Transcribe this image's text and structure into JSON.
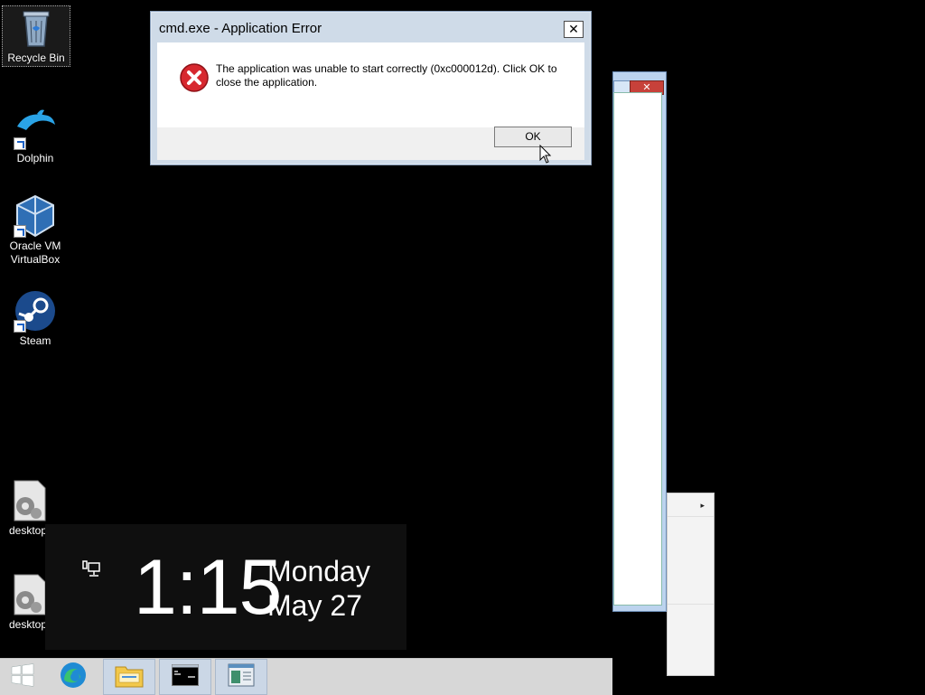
{
  "desktop": {
    "icons": [
      {
        "label": "Recycle Bin",
        "icon": "recycle-bin-icon"
      },
      {
        "label": "Dolphin",
        "icon": "dolphin-icon"
      },
      {
        "label": "Oracle VM\nVirtualBox",
        "icon": "virtualbox-icon"
      },
      {
        "label": "Steam",
        "icon": "steam-icon"
      },
      {
        "label": "desktop",
        "icon": "settings-file-icon"
      },
      {
        "label": "desktop",
        "icon": "settings-file-icon"
      }
    ]
  },
  "dialog": {
    "title": "cmd.exe - Application Error",
    "message": "The application was unable to start correctly (0xc000012d). Click OK to close the application.",
    "ok_label": "OK",
    "close_label": "✕"
  },
  "background_window": {
    "close_label": "✕"
  },
  "clock": {
    "time": "1:15",
    "day": "Monday",
    "date": "May 27"
  },
  "taskbar": {
    "buttons": [
      {
        "name": "start",
        "icon": "windows-logo-icon"
      },
      {
        "name": "edge",
        "icon": "edge-icon"
      },
      {
        "name": "file-explorer",
        "icon": "folder-icon"
      },
      {
        "name": "command-prompt",
        "icon": "cmd-icon"
      },
      {
        "name": "app-window",
        "icon": "window-icon"
      }
    ]
  },
  "colors": {
    "desktop_bg": "#000000",
    "error_red": "#d7282f",
    "taskbar_bg": "#d7d7d7"
  }
}
